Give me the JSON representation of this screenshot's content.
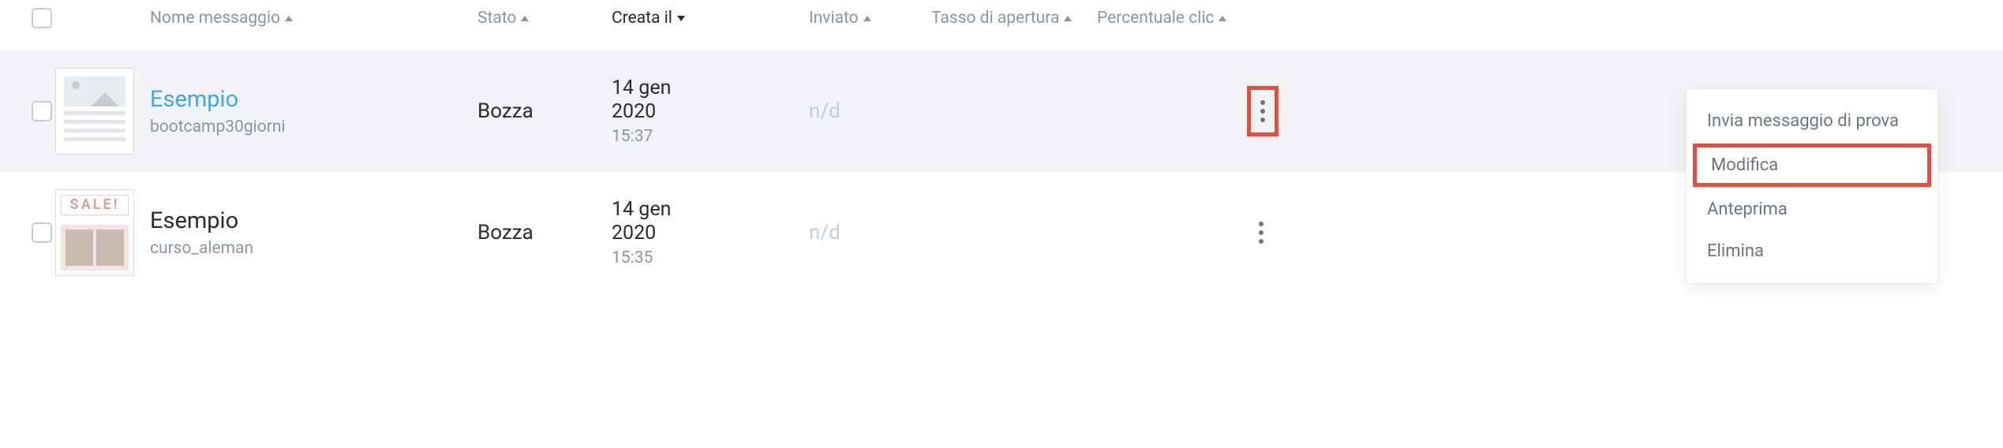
{
  "headers": {
    "name": "Nome messaggio",
    "status": "Stato",
    "created": "Creata il",
    "sent": "Inviato",
    "open_rate": "Tasso di apertura",
    "click_rate": "Percentuale clic"
  },
  "rows": [
    {
      "name": "Esempio",
      "sub": "bootcamp30giorni",
      "status": "Bozza",
      "date_line1": "14 gen",
      "date_line2": "2020",
      "date_time": "15:37",
      "sent": "n/d"
    },
    {
      "name": "Esempio",
      "sub": "curso_aleman",
      "status": "Bozza",
      "date_line1": "14 gen",
      "date_line2": "2020",
      "date_time": "15:35",
      "sent": "n/d"
    }
  ],
  "menu": {
    "send_test": "Invia messaggio di prova",
    "edit": "Modifica",
    "preview": "Anteprima",
    "delete": "Elimina"
  },
  "thumb_sale_label": "SALE!"
}
